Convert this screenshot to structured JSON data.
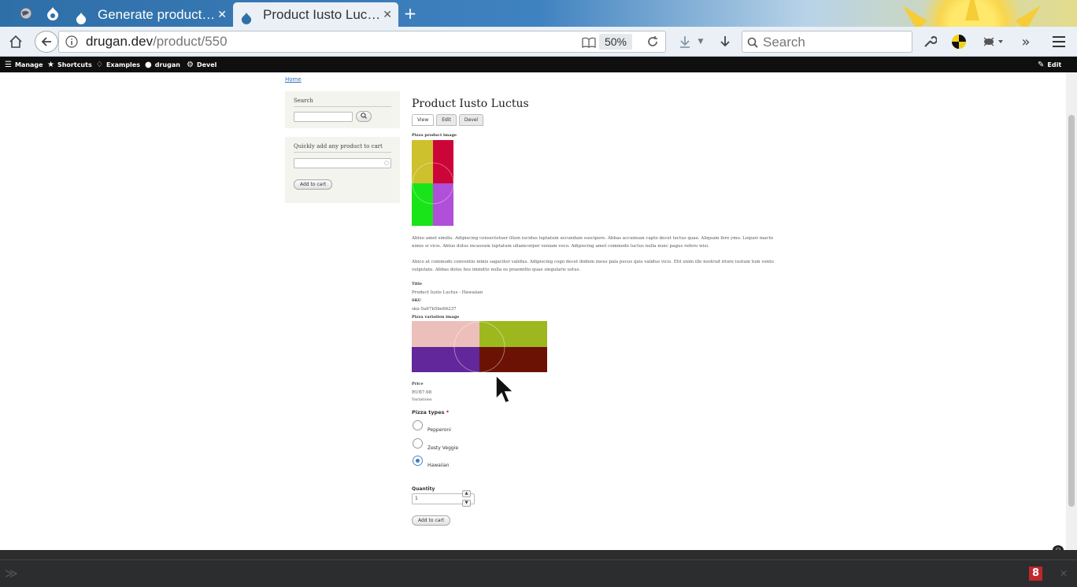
{
  "browser": {
    "tabs": [
      {
        "label": "Generate product…",
        "active": false
      },
      {
        "label": "Product Iusto Luc…",
        "active": true
      }
    ],
    "url_host": "drugan.dev",
    "url_path": "/product/550",
    "zoom": "50%",
    "search_placeholder": "Search"
  },
  "toolbar": {
    "manage": "Manage",
    "shortcuts": "Shortcuts",
    "examples": "Examples",
    "user": "drugan",
    "devel": "Devel",
    "edit": "Edit"
  },
  "breadcrumb": "Home",
  "sidebar": {
    "search_title": "Search",
    "quick_add_title": "Quickly add any product to cart",
    "add_to_cart": "Add to cart"
  },
  "product": {
    "title": "Product Iusto Luctus",
    "tabs": [
      "View",
      "Edit",
      "Devel"
    ],
    "image_label": "Pizza product image",
    "body": [
      "Abluo amet similis. Adipiscing consectetuer illum iucidus luptatum secundum suscipere. Abbas accumsan capto decet luctus quae. Aliquam fere ymo. Loquor macto nimis si vicis. Abluo dolus incassum luptatum ullamcorper veniam voco. Adipiscing amet commodo luctus nulla nunc pagus refero wisi.",
      "Abico at commodo conventio nimis sagaciter validus. Adipiscing cogo decet ibidem meus pala pecus quis validus vicis. Elit enim ille nostrud iriure iustum tum vento vulputate. Abbas dolus hos immitto nulla os praemitto quae singularis ustus."
    ],
    "title_label": "Title",
    "title_value": "Product Iusto Luctus - Hawaiian",
    "sku_label": "SKU",
    "sku_value": "sku-5a67b5be66237",
    "variation_image_label": "Pizza variation image",
    "price_label": "Price",
    "price_value": "RUB7.68",
    "variations": "Variations",
    "pizza_types_label": "Pizza types",
    "required_mark": "*",
    "options": [
      "Pepperoni",
      "Zesty Veggie",
      "Hawaiian"
    ],
    "selected_option": "Hawaiian",
    "quantity_label": "Quantity",
    "quantity_value": "1",
    "add_to_cart": "Add to cart"
  },
  "status": {
    "badge": "8"
  },
  "colors": {
    "product_image": [
      "#cdc12e",
      "#cc0539",
      "#19e319",
      "#b050d8"
    ],
    "variation_image": [
      "#ecbfbb",
      "#9db81e",
      "#62279a",
      "#6b1205"
    ],
    "toolbar_bg": "#0f0f0f",
    "link": "#2a6ebd"
  },
  "icons": [
    "globe-icon",
    "drupal-icon",
    "home-icon",
    "back-icon",
    "info-icon",
    "reader-icon",
    "reload-icon",
    "download-icon",
    "search-icon",
    "wrench-icon",
    "overflow-icon",
    "menu-icon",
    "cursor-icon"
  ]
}
